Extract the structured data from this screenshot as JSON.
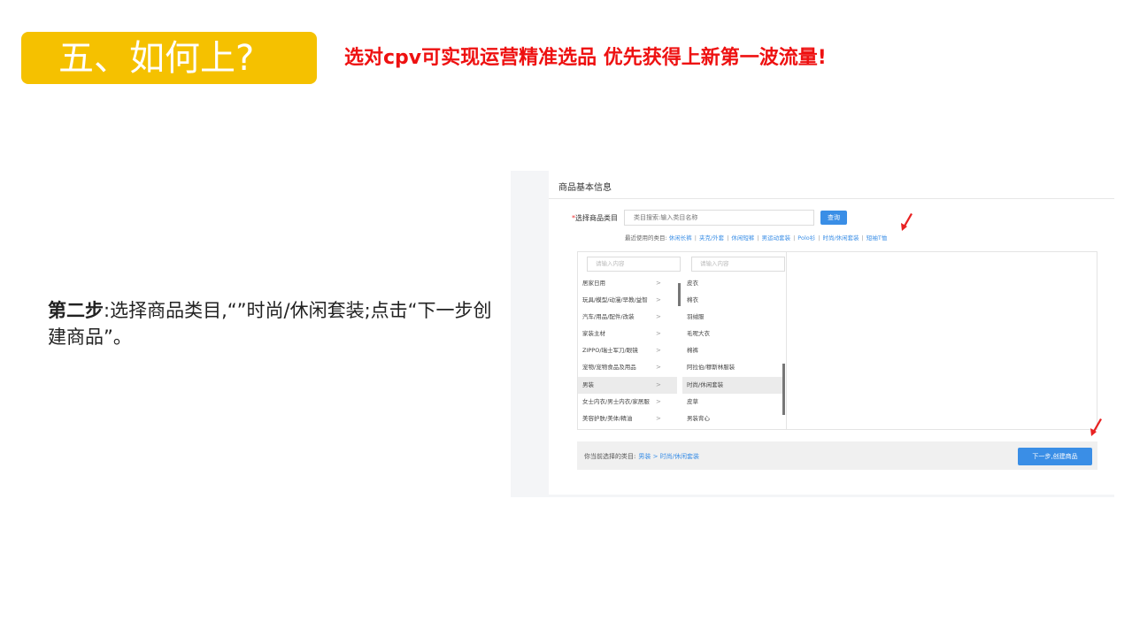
{
  "header": {
    "title": "五、如何上?",
    "subtitle": "选对cpv可实现运营精准选品 优先获得上新第一波流量!"
  },
  "instruction": {
    "strong": "第二步",
    "text": ":选择商品类目,“”时尚/休闲套装;点击“下一步创建商品”。"
  },
  "screenshot": {
    "panel_title": "商品基本信息",
    "field_required_mark": "*",
    "field_label": "选择商品类目",
    "search_placeholder": "类目搜索:输入类目名称",
    "query_button": "查询",
    "recent_label": "最近使用的类目:",
    "recent_tags": [
      "休闲长裤",
      "夹克/外套",
      "休闲短裤",
      "男运动套装",
      "Polo衫",
      "时尚/休闲套装",
      "短袖T恤"
    ],
    "recent_separator": "|",
    "filter_placeholder_1": "请输入内容",
    "filter_placeholder_2": "请输入内容",
    "arrow_glyph": ">",
    "categories": [
      "居家日用",
      "玩具/模型/动漫/早教/益智",
      "汽车/用品/配件/改装",
      "家装主材",
      "ZIPPO/瑞士军刀/眼镜",
      "宠物/宠物食品及用品",
      "男装",
      "女士内衣/男士内衣/家居服",
      "美容护肤/美体/精油"
    ],
    "subcategories": [
      "皮衣",
      "棉衣",
      "羽绒服",
      "毛呢大衣",
      "棉裤",
      "阿拉伯/穆斯林服装",
      "时尚/休闲套装",
      "皮草",
      "男装背心"
    ],
    "bottom_label": "你当前选择的类目:",
    "bottom_path": "男装 > 时尚/休闲套装",
    "next_button": "下一步,创建商品"
  },
  "colors": {
    "accent_yellow": "#f5c100",
    "subtitle_red": "#ee1111",
    "link_blue": "#3a8ee6",
    "pointer_red": "#e82222"
  }
}
